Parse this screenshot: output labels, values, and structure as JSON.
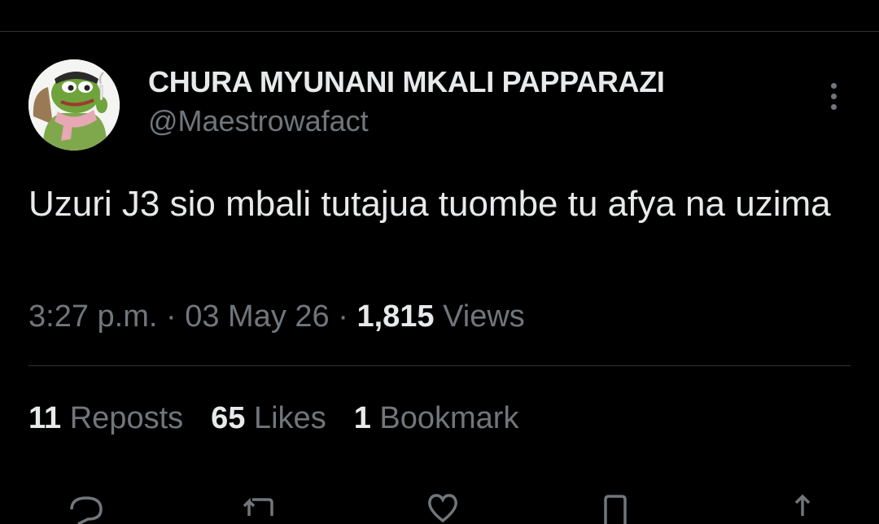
{
  "tweet": {
    "author": {
      "display_name": "CHURA MYUNANI MKALI PAPPARAZI",
      "handle": "@Maestrowafact",
      "avatar_icon": "pepe-frog-avatar"
    },
    "text": "Uzuri J3 sio mbali tutajua tuombe tu afya na uzima",
    "meta": {
      "time": "3:27 p.m.",
      "separator": "·",
      "date": "03 May 26",
      "views_count": "1,815",
      "views_label": "Views"
    },
    "stats": [
      {
        "count": "11",
        "label": "Reposts"
      },
      {
        "count": "65",
        "label": "Likes"
      },
      {
        "count": "1",
        "label": "Bookmark"
      }
    ],
    "actions": [
      "reply-icon",
      "repost-icon",
      "like-icon",
      "bookmark-icon",
      "share-icon"
    ]
  },
  "colors": {
    "background": "#000000",
    "primary_text": "#e7e9ea",
    "secondary_text": "#71767b",
    "divider": "#2f3336"
  }
}
